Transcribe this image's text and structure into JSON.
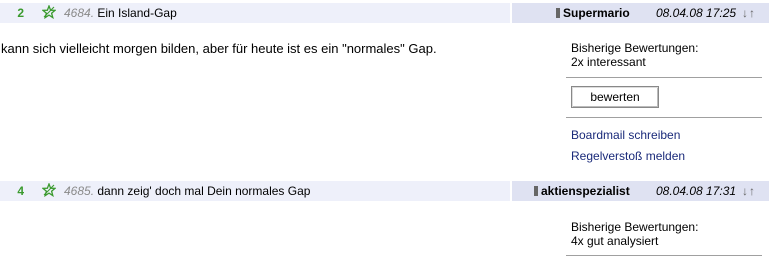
{
  "posts": [
    {
      "count": "2",
      "number": "4684.",
      "title": "Ein Island-Gap",
      "author": "Supermario",
      "date": "08.04.08 17:25",
      "arrows": "↓↑",
      "body": "kann sich vielleicht morgen bilden, aber für heute ist es ein \"normales\" Gap.",
      "ratings_label": "Bisherige Bewertungen:",
      "ratings_value": "2x interessant",
      "rate_button": "bewerten",
      "links": [
        "Boardmail schreiben",
        "Regelverstoß melden"
      ]
    },
    {
      "count": "4",
      "number": "4685.",
      "title": "dann zeig' doch mal Dein normales Gap",
      "author": "aktienspezialist",
      "date": "08.04.08 17:31",
      "arrows": "↓↑",
      "ratings_label": "Bisherige Bewertungen:",
      "ratings_value": "4x gut analysiert"
    }
  ],
  "colors": {
    "header_left": "#eef0fa",
    "header_right": "#dfe2f2",
    "count_green": "#3a9a2e",
    "link_blue": "#1a2a7a"
  },
  "icons": {
    "star": "star-award-icon",
    "online": "user-status-icon"
  }
}
